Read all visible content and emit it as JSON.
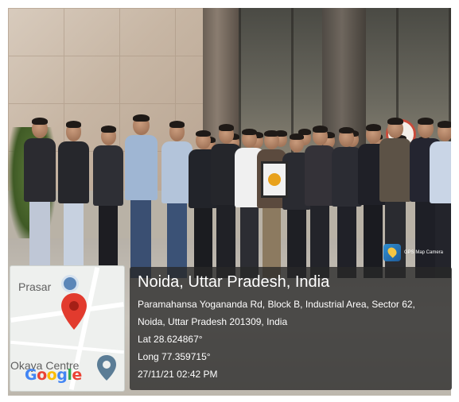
{
  "gps": {
    "brand": "GPS Map Camera",
    "location_title": "Noida, Uttar Pradesh, India",
    "address_line1": "Paramahansa Yogananda Rd, Block B, Industrial Area, Sector 62,",
    "address_line2": "Noida, Uttar Pradesh 201309, India",
    "lat": "Lat 28.624867°",
    "long": "Long 77.359715°",
    "datetime": "27/11/21 02:42 PM"
  },
  "map": {
    "label_top": "Prasar",
    "label_bottom": "Okaya Centre",
    "logo": "Google",
    "pin_color": "#e23b2e",
    "icons": [
      "broadcast-icon",
      "location-pin-icon",
      "place-pin-icon"
    ]
  },
  "colors": {
    "overlay_bg": "#282828",
    "google_blue": "#4285f4",
    "google_red": "#ea4335",
    "google_yellow": "#fbbc05",
    "google_green": "#34a853"
  }
}
